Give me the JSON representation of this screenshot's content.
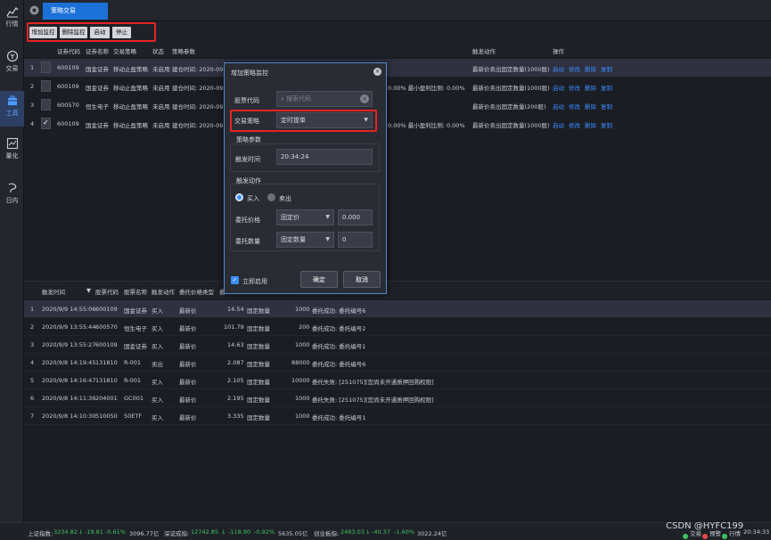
{
  "sidebar": {
    "items": [
      {
        "label": "行情",
        "icon": "chart-icon"
      },
      {
        "label": "交易",
        "icon": "trade-icon"
      },
      {
        "label": "工具",
        "icon": "toolbox-icon",
        "active": true
      },
      {
        "label": "量化",
        "icon": "quant-icon"
      },
      {
        "label": "日内",
        "icon": "intraday-icon"
      }
    ]
  },
  "tabs": {
    "active": "策略交易",
    "icon": "gear-icon"
  },
  "toolbar": {
    "add": "增加监控",
    "delete": "删除监控",
    "start": "启动",
    "stop": "停止"
  },
  "upper_table": {
    "headers": {
      "code": "证券代码",
      "name": "证券名称",
      "strategy": "交易策略",
      "status": "状态",
      "params": "策略参数",
      "trigger": "触发动作",
      "ops": "操作"
    },
    "rows": [
      {
        "idx": "1",
        "code": "600109",
        "name": "国金证券",
        "strategy": "移动止盈策略",
        "status": "未启用",
        "params": "建仓时间: 2020-09",
        "extra": "",
        "trigger": "最新价卖出固定数量(1000股)",
        "checked": false
      },
      {
        "idx": "2",
        "code": "600109",
        "name": "国金证券",
        "strategy": "移动止盈策略",
        "status": "未启用",
        "params": "建仓时间: 2020-09",
        "extra": "0.00%  最小盈利比例: 0.00%",
        "trigger": "最新价卖出固定数量(1000股)",
        "checked": false
      },
      {
        "idx": "3",
        "code": "600570",
        "name": "恒生电子",
        "strategy": "移动止盈策略",
        "status": "未启用",
        "params": "建仓时间: 2020-09",
        "extra": "",
        "trigger": "最新价卖出固定数量(200股)",
        "checked": false
      },
      {
        "idx": "4",
        "code": "600109",
        "name": "国金证券",
        "strategy": "移动止盈策略",
        "status": "未启用",
        "params": "建仓时间: 2020-09",
        "extra": "0.00%  最小盈利比例: 0.00%",
        "trigger": "最新价卖出固定数量(1000股)",
        "checked": true
      }
    ],
    "ops": {
      "start": "启动",
      "edit": "修改",
      "delete": "删除",
      "copy": "复制"
    }
  },
  "lower_table": {
    "headers": {
      "time": "触发时间",
      "code": "股票代码",
      "name": "股票名称",
      "action": "触发动作",
      "price_type": "委托价格类型",
      "more": "委"
    },
    "rows": [
      {
        "idx": "1",
        "time": "2020/9/9 14:55:06",
        "code": "600109",
        "name": "国金证券",
        "action": "买入",
        "ptype": "最新价",
        "price": "14.54",
        "qtype": "固定数量",
        "qty": "1000",
        "result": "委托成功: 委托编号6"
      },
      {
        "idx": "2",
        "time": "2020/9/9 13:55:44",
        "code": "600570",
        "name": "恒生电子",
        "action": "买入",
        "ptype": "最新价",
        "price": "101.79",
        "qtype": "固定数量",
        "qty": "200",
        "result": "委托成功: 委托编号2"
      },
      {
        "idx": "3",
        "time": "2020/9/9 13:55:27",
        "code": "600109",
        "name": "国金证券",
        "action": "买入",
        "ptype": "最新价",
        "price": "14.63",
        "qtype": "固定数量",
        "qty": "1000",
        "result": "委托成功: 委托编号1"
      },
      {
        "idx": "4",
        "time": "2020/9/8 14:19:45",
        "code": "131810",
        "name": "R-001",
        "action": "卖出",
        "ptype": "最新价",
        "price": "2.087",
        "qtype": "固定数量",
        "qty": "88000",
        "result": "委托成功: 委托编号6"
      },
      {
        "idx": "5",
        "time": "2020/9/8 14:16:47",
        "code": "131810",
        "name": "R-001",
        "action": "买入",
        "ptype": "最新价",
        "price": "2.105",
        "qtype": "固定数量",
        "qty": "10000",
        "result": "委托失败: [251075][您尚未开通质押回购权限]"
      },
      {
        "idx": "6",
        "time": "2020/9/8 14:11:36",
        "code": "204001",
        "name": "GC001",
        "action": "买入",
        "ptype": "最新价",
        "price": "2.195",
        "qtype": "固定数量",
        "qty": "1000",
        "result": "委托失败: [251075][您尚未开通质押回购权限]"
      },
      {
        "idx": "7",
        "time": "2020/9/8 14:10:30",
        "code": "510050",
        "name": "50ETF",
        "action": "买入",
        "ptype": "最新价",
        "price": "3.335",
        "qtype": "固定数量",
        "qty": "1000",
        "result": "委托成功: 委托编号1"
      }
    ]
  },
  "dialog": {
    "title": "增加策略监控",
    "code_label": "股票代码",
    "code_placeholder": "搜索代码",
    "strategy_label": "交易策略",
    "strategy_value": "定时提单",
    "params_group": "策略参数",
    "trigger_time_label": "触发时间",
    "trigger_time_value": "20:34:24",
    "action_group": "触发动作",
    "buy": "买入",
    "sell": "卖出",
    "price_label": "委托价格",
    "price_type": "固定价",
    "price_value": "0.000",
    "qty_label": "委托数量",
    "qty_type": "固定数量",
    "qty_value": "0",
    "enable_label": "立即启用",
    "ok": "确定",
    "cancel": "取消"
  },
  "status_bar": {
    "sh_label": "上证指数:",
    "sh_value": "3234.82",
    "sh_change": "-19.81",
    "sh_pct": "-0.61%",
    "sh_amount": "3096.77亿",
    "sz_label": "深证成指:",
    "sz_value": "12742.85",
    "sz_change": "-118.90",
    "sz_pct": "-0.92%",
    "sz_amount": "5635.05亿",
    "cy_label": "创业板指:",
    "cy_value": "2483.03",
    "cy_change": "-40.37",
    "cy_pct": "-1.60%",
    "cy_amount": "3022.24亿",
    "right_label1": "交易",
    "right_label2": "预警",
    "right_label3": "行情",
    "time": "20:34:33"
  },
  "watermark": "CSDN @HYFC199"
}
